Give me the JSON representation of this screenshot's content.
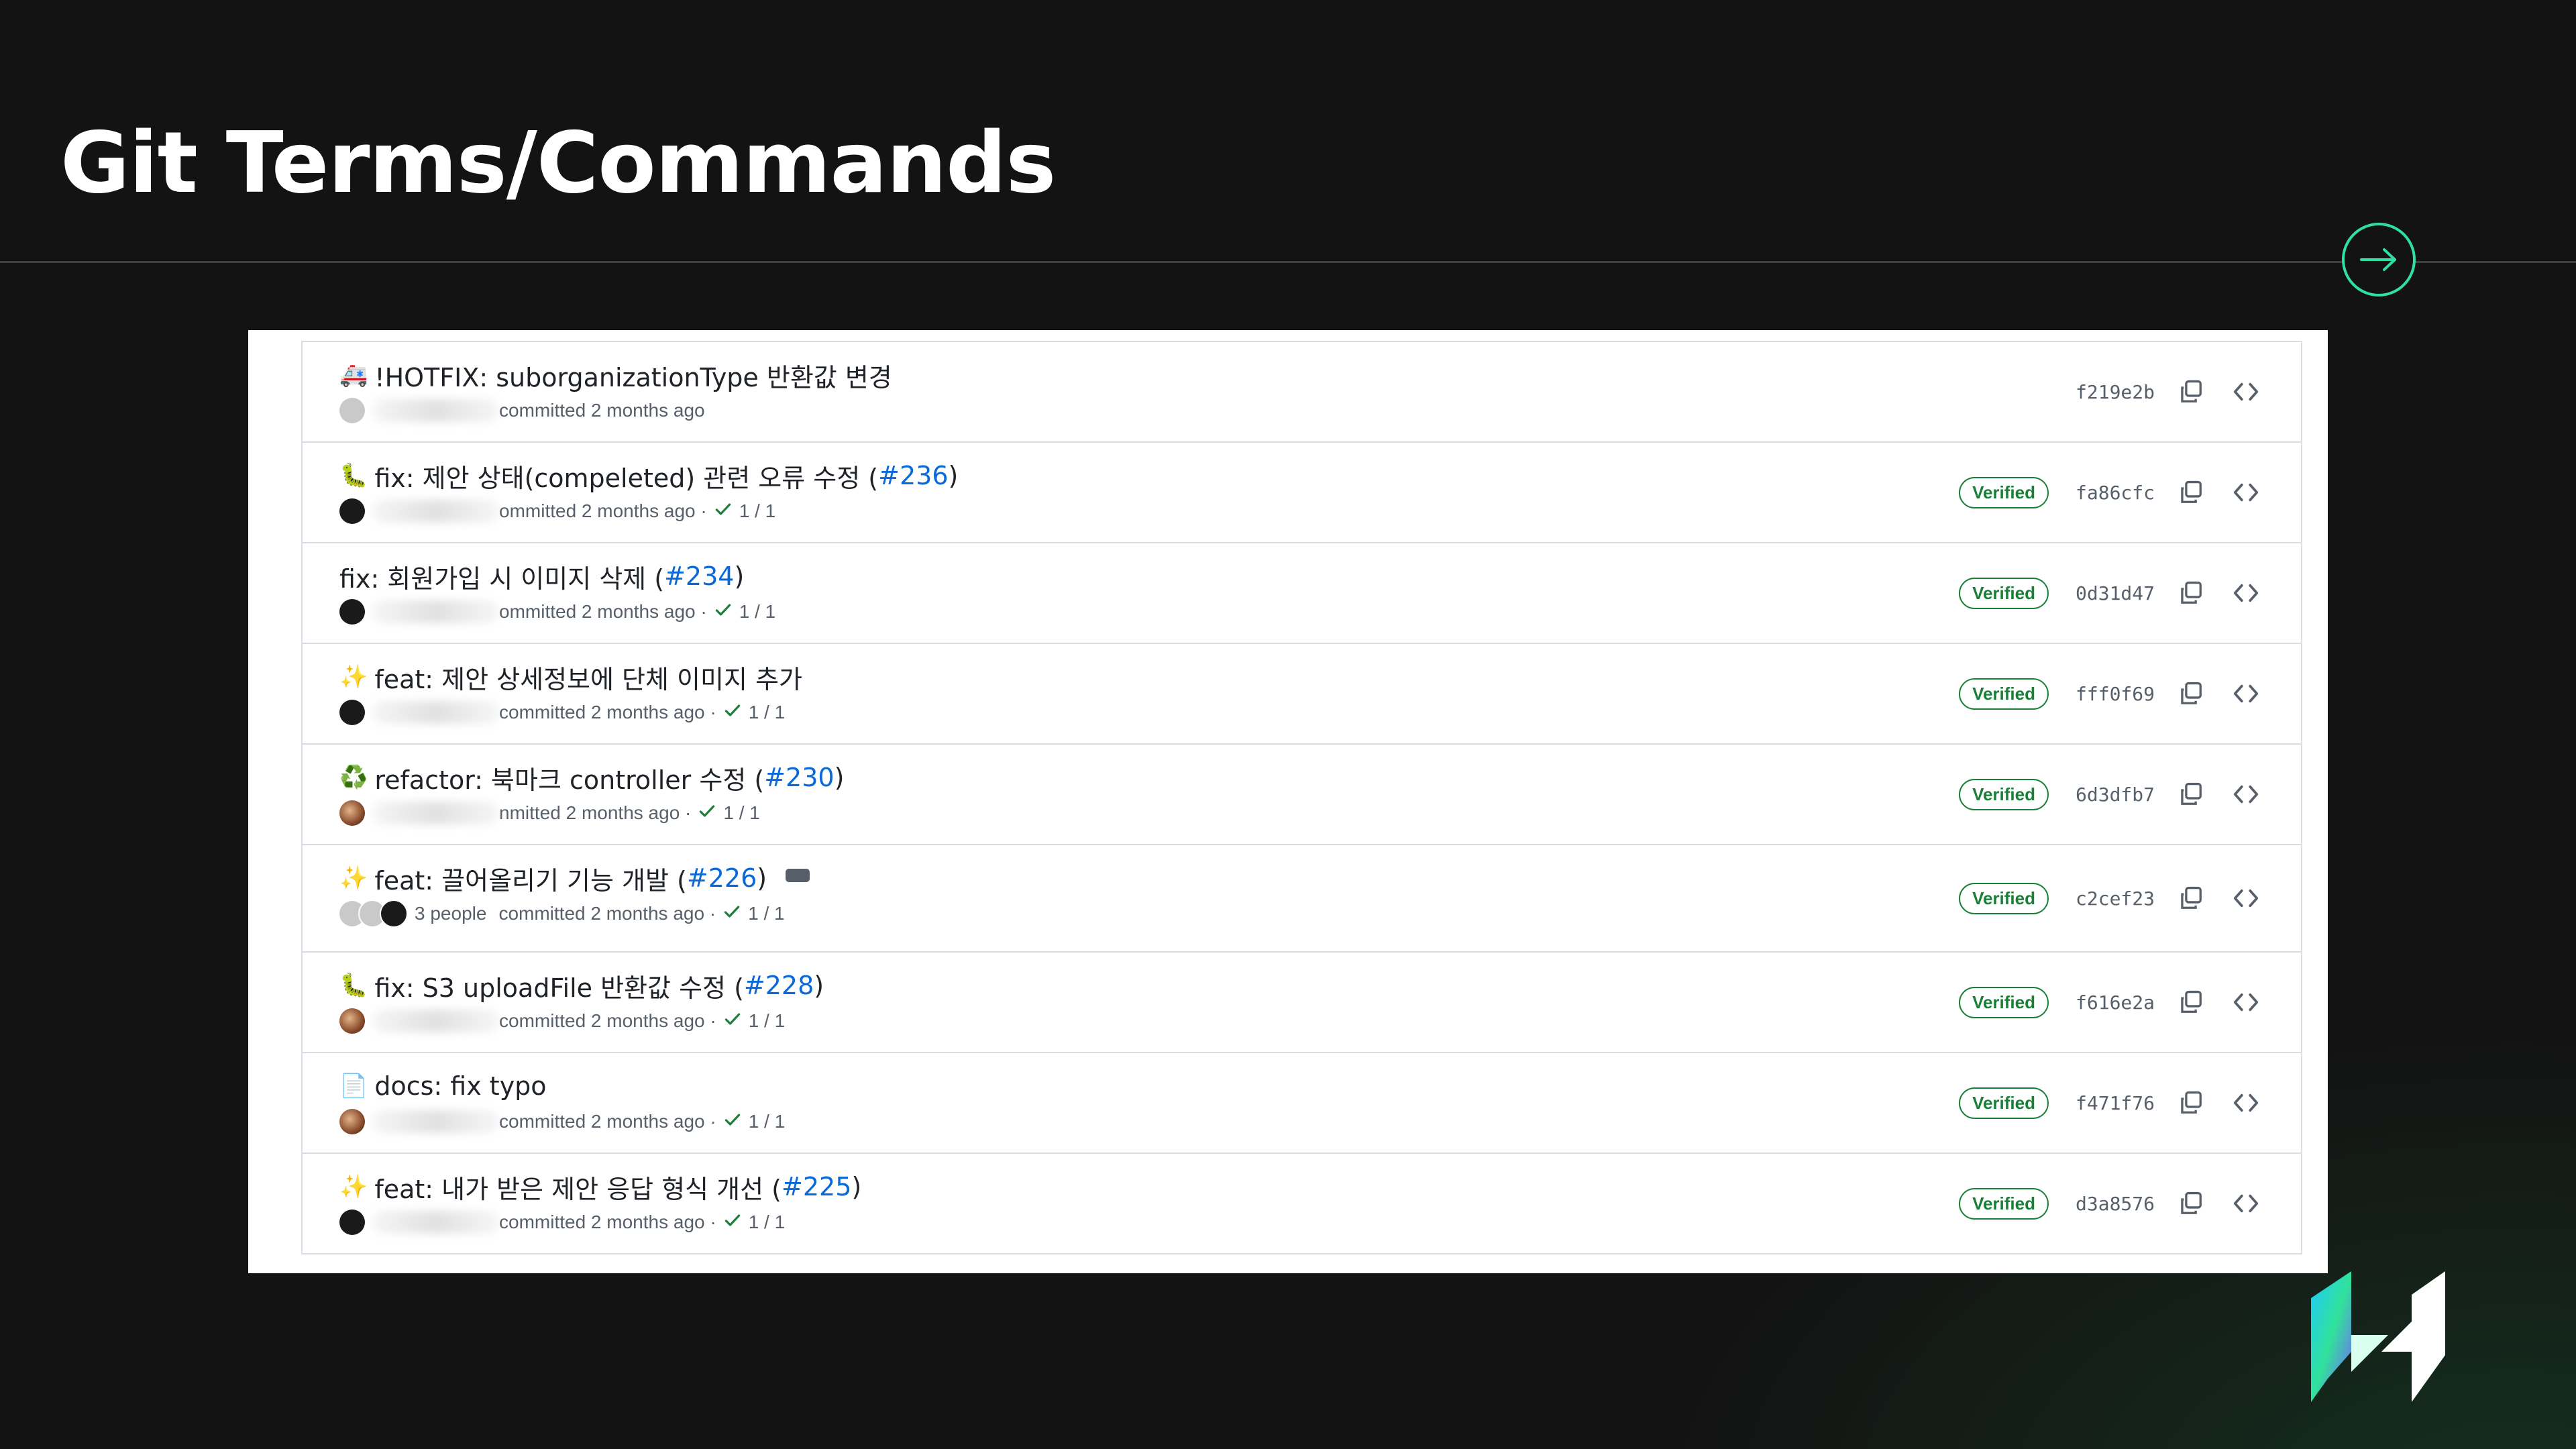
{
  "slide": {
    "title": "Git Terms/Commands",
    "next_icon": "arrow-right-circle-icon",
    "accent_color": "#2fe0a4"
  },
  "commits": [
    {
      "emoji": "🚑",
      "message": "!HOTFIX: suborganizationType 반환값 변경",
      "pr": "",
      "meta": "committed 2 months ago",
      "checks": "",
      "verified": "",
      "sha": "f219e2b",
      "avatar": "gray"
    },
    {
      "emoji": "🐛",
      "message": "fix: 제안 상태(compeleted) 관련 오류 수정 (",
      "pr": "#236",
      "meta": "ommitted 2 months ago ·",
      "checks": "1 / 1",
      "verified": "Verified",
      "sha": "fa86cfc",
      "avatar": "dark"
    },
    {
      "emoji": "",
      "message": "fix: 회원가입 시 이미지 삭제 (",
      "pr": "#234",
      "meta": "ommitted 2 months ago ·",
      "checks": "1 / 1",
      "verified": "Verified",
      "sha": "0d31d47",
      "avatar": "dark"
    },
    {
      "emoji": "✨",
      "message": "feat: 제안 상세정보에 단체 이미지 추가",
      "pr": "",
      "meta": "committed 2 months ago ·",
      "checks": "1 / 1",
      "verified": "Verified",
      "sha": "fff0f69",
      "avatar": "dark"
    },
    {
      "emoji": "♻️",
      "message": "refactor: 북마크 controller 수정 (",
      "pr": "#230",
      "meta": "nmitted 2 months ago ·",
      "checks": "1 / 1",
      "verified": "Verified",
      "sha": "6d3dfb7",
      "avatar": "photo"
    },
    {
      "emoji": "✨",
      "message": "feat: 끌어올리기 기능 개발 (",
      "pr": "#226",
      "meta": "committed 2 months ago ·",
      "checks": "1 / 1",
      "verified": "Verified",
      "sha": "c2cef23",
      "avatar": "group",
      "people": "3 people"
    },
    {
      "emoji": "🐛",
      "message": "fix: S3 uploadFile 반환값 수정 (",
      "pr": "#228",
      "meta": "committed 2 months ago ·",
      "checks": "1 / 1",
      "verified": "Verified",
      "sha": "f616e2a",
      "avatar": "photo"
    },
    {
      "emoji": "📄",
      "message": "docs: fix typo",
      "pr": "",
      "meta": "committed 2 months ago ·",
      "checks": "1 / 1",
      "verified": "Verified",
      "sha": "f471f76",
      "avatar": "photo"
    },
    {
      "emoji": "✨",
      "message": "feat: 내가 받은 제안 응답 형식 개선 (",
      "pr": "#225",
      "meta": "committed 2 months ago ·",
      "checks": "1 / 1",
      "verified": "Verified",
      "sha": "d3a8576",
      "avatar": "dark"
    }
  ],
  "icons": {
    "copy": "copy-icon",
    "browse": "code-brackets-icon",
    "check": "check-icon",
    "more": "ellipsis-icon"
  },
  "colors": {
    "verified": "#1a7f37",
    "link": "#0969da"
  }
}
